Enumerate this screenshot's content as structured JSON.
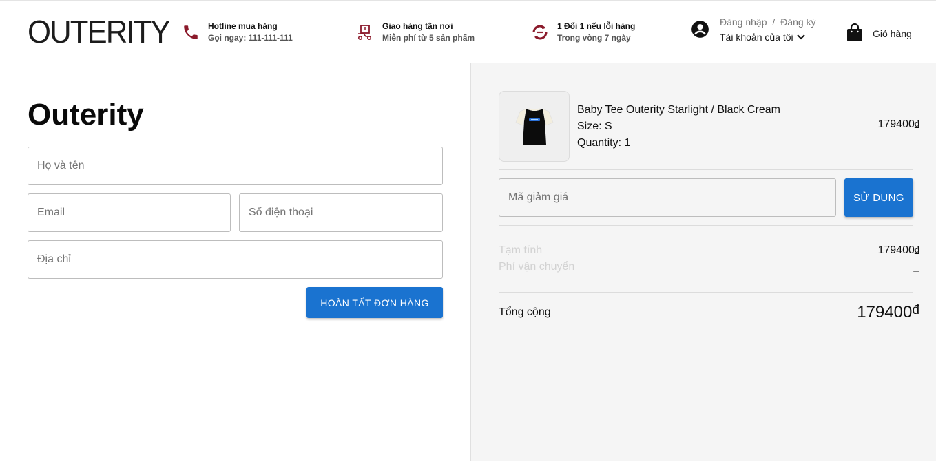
{
  "header": {
    "logo": "OUTERITY",
    "features": [
      {
        "icon": "phone-icon",
        "title": "Hotline mua hàng",
        "subtitle": "Gọi ngay: 111-111-111"
      },
      {
        "icon": "delivery-icon",
        "title": "Giao hàng tận nơi",
        "subtitle": "Miễn phí từ 5 sản phẩm"
      },
      {
        "icon": "exchange-icon",
        "title": "1 Đổi 1 nếu lỗi hàng",
        "subtitle": "Trong vòng 7 ngày"
      }
    ],
    "account": {
      "login": "Đăng nhập",
      "separator": "/",
      "register": "Đăng ký",
      "my_account": "Tài khoản của tôi"
    },
    "cart_label": "Giỏ hàng"
  },
  "checkout": {
    "shop_name": "Outerity",
    "fields": {
      "name_placeholder": "Họ và tên",
      "email_placeholder": "Email",
      "phone_placeholder": "Số điện thoại",
      "address_placeholder": "Địa chỉ"
    },
    "submit_label": "HOÀN TẤT ĐƠN HÀNG"
  },
  "order": {
    "product_name": "Baby Tee Outerity Starlight / Black Cream",
    "size": "Size: S",
    "quantity": "Quantity: 1",
    "price": "179400",
    "currency": "đ",
    "promo_placeholder": "Mã giảm giá",
    "apply_label": "SỬ DỤNG",
    "subtotal_label": "Tạm tính",
    "subtotal_value": "179400",
    "shipping_label": "Phí vận chuyển",
    "shipping_value": "–",
    "total_label": "Tổng cộng",
    "total_value": "179400"
  },
  "colors": {
    "accent": "#1a73d0",
    "icon_red": "#8b1a2b"
  }
}
